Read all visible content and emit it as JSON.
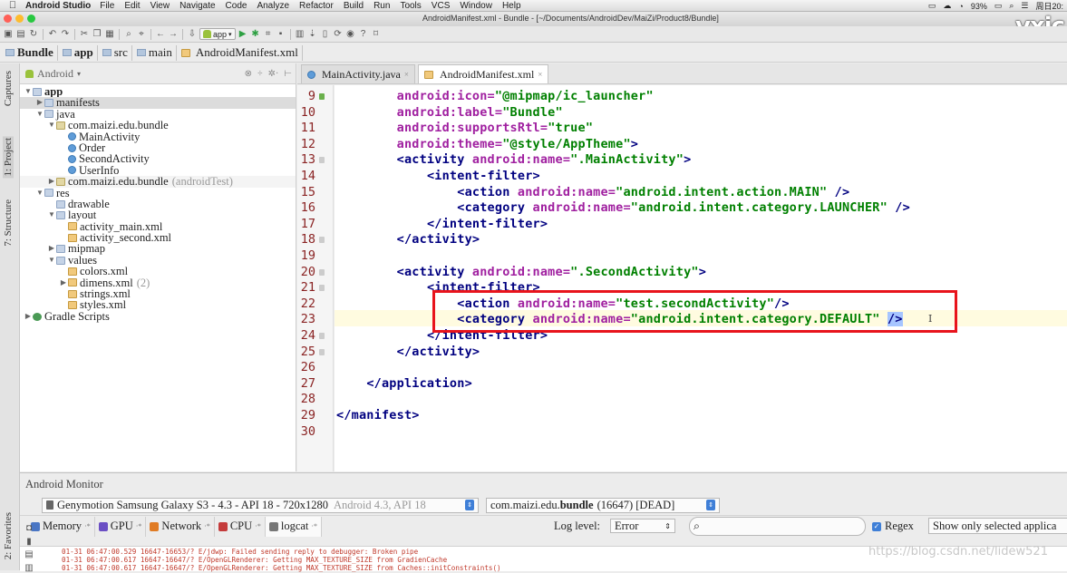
{
  "menubar": {
    "app": "Android Studio",
    "items": [
      "File",
      "Edit",
      "View",
      "Navigate",
      "Code",
      "Analyze",
      "Refactor",
      "Build",
      "Run",
      "Tools",
      "VCS",
      "Window",
      "Help"
    ],
    "battery": "93%",
    "clock": "周日20:"
  },
  "window": {
    "title": "AndroidManifest.xml - Bundle - [~/Documents/AndroidDev/MaiZi/Product8/Bundle]"
  },
  "toolbar": {
    "run_config": "app"
  },
  "breadcrumb": [
    "Bundle",
    "app",
    "src",
    "main",
    "AndroidManifest.xml"
  ],
  "leftstrip": {
    "captures": "Captures",
    "project": "1: Project",
    "structure": "7: Structure",
    "favorites": "2: Favorites"
  },
  "project": {
    "view": "Android",
    "tree": [
      {
        "label": "app",
        "depth": 0,
        "icon": "fold",
        "open": true,
        "bold": true
      },
      {
        "label": "manifests",
        "depth": 1,
        "icon": "fold",
        "open": false,
        "sel": true
      },
      {
        "label": "java",
        "depth": 1,
        "icon": "fold",
        "open": true
      },
      {
        "label": "com.maizi.edu.bundle",
        "depth": 2,
        "icon": "pkg",
        "open": true
      },
      {
        "label": "MainActivity",
        "depth": 3,
        "icon": "cls"
      },
      {
        "label": "Order",
        "depth": 3,
        "icon": "cls"
      },
      {
        "label": "SecondActivity",
        "depth": 3,
        "icon": "cls"
      },
      {
        "label": "UserInfo",
        "depth": 3,
        "icon": "cls"
      },
      {
        "label": "com.maizi.edu.bundle",
        "depth": 2,
        "icon": "pkg",
        "open": false,
        "muted": "(androidTest)",
        "hl": true
      },
      {
        "label": "res",
        "depth": 1,
        "icon": "fold",
        "open": true
      },
      {
        "label": "drawable",
        "depth": 2,
        "icon": "fold"
      },
      {
        "label": "layout",
        "depth": 2,
        "icon": "fold",
        "open": true
      },
      {
        "label": "activity_main.xml",
        "depth": 3,
        "icon": "xml"
      },
      {
        "label": "activity_second.xml",
        "depth": 3,
        "icon": "xml"
      },
      {
        "label": "mipmap",
        "depth": 2,
        "icon": "fold",
        "open": false
      },
      {
        "label": "values",
        "depth": 2,
        "icon": "fold",
        "open": true
      },
      {
        "label": "colors.xml",
        "depth": 3,
        "icon": "xml"
      },
      {
        "label": "dimens.xml",
        "depth": 3,
        "icon": "xml",
        "open": false,
        "muted": "(2)"
      },
      {
        "label": "strings.xml",
        "depth": 3,
        "icon": "xml"
      },
      {
        "label": "styles.xml",
        "depth": 3,
        "icon": "xml"
      },
      {
        "label": "Gradle Scripts",
        "depth": 0,
        "icon": "grad",
        "open": false
      }
    ]
  },
  "editor": {
    "tabs": [
      {
        "label": "MainActivity.java",
        "active": false
      },
      {
        "label": "AndroidManifest.xml",
        "active": true
      }
    ],
    "line_numbers": [
      "9",
      "10",
      "11",
      "12",
      "13",
      "14",
      "15",
      "16",
      "17",
      "18",
      "19",
      "20",
      "21",
      "22",
      "23",
      "24",
      "25",
      "26",
      "27",
      "28",
      "29",
      "30"
    ],
    "lines": [
      [
        {
          "t": "        ",
          "c": "pl"
        },
        {
          "t": "android:icon=",
          "c": "at"
        },
        {
          "t": "\"@mipmap/ic_launcher\"",
          "c": "vl"
        }
      ],
      [
        {
          "t": "        ",
          "c": "pl"
        },
        {
          "t": "android:label=",
          "c": "at"
        },
        {
          "t": "\"Bundle\"",
          "c": "vl"
        }
      ],
      [
        {
          "t": "        ",
          "c": "pl"
        },
        {
          "t": "android:supportsRtl=",
          "c": "at"
        },
        {
          "t": "\"true\"",
          "c": "vl"
        }
      ],
      [
        {
          "t": "        ",
          "c": "pl"
        },
        {
          "t": "android:theme=",
          "c": "at"
        },
        {
          "t": "\"@style/AppTheme\"",
          "c": "vl"
        },
        {
          "t": ">",
          "c": "tg"
        }
      ],
      [
        {
          "t": "        ",
          "c": "pl"
        },
        {
          "t": "<activity ",
          "c": "tg"
        },
        {
          "t": "android:name=",
          "c": "at"
        },
        {
          "t": "\".MainActivity\"",
          "c": "vl"
        },
        {
          "t": ">",
          "c": "tg"
        }
      ],
      [
        {
          "t": "            ",
          "c": "pl"
        },
        {
          "t": "<intent-filter>",
          "c": "tg"
        }
      ],
      [
        {
          "t": "                ",
          "c": "pl"
        },
        {
          "t": "<action ",
          "c": "tg"
        },
        {
          "t": "android:name=",
          "c": "at"
        },
        {
          "t": "\"android.intent.action.MAIN\"",
          "c": "vl"
        },
        {
          "t": " />",
          "c": "tg"
        }
      ],
      [
        {
          "t": "                ",
          "c": "pl"
        },
        {
          "t": "<category ",
          "c": "tg"
        },
        {
          "t": "android:name=",
          "c": "at"
        },
        {
          "t": "\"android.intent.category.LAUNCHER\"",
          "c": "vl"
        },
        {
          "t": " />",
          "c": "tg"
        }
      ],
      [
        {
          "t": "            ",
          "c": "pl"
        },
        {
          "t": "</intent-filter>",
          "c": "tg"
        }
      ],
      [
        {
          "t": "        ",
          "c": "pl"
        },
        {
          "t": "</activity>",
          "c": "tg"
        }
      ],
      [
        {
          "t": "",
          "c": "pl"
        }
      ],
      [
        {
          "t": "        ",
          "c": "pl"
        },
        {
          "t": "<activity ",
          "c": "tg"
        },
        {
          "t": "android:name=",
          "c": "at"
        },
        {
          "t": "\".SecondActivity\"",
          "c": "vl"
        },
        {
          "t": ">",
          "c": "tg"
        }
      ],
      [
        {
          "t": "            ",
          "c": "pl"
        },
        {
          "t": "<intent-filter>",
          "c": "tg"
        }
      ],
      [
        {
          "t": "                ",
          "c": "pl"
        },
        {
          "t": "<action ",
          "c": "tg"
        },
        {
          "t": "android:name=",
          "c": "at"
        },
        {
          "t": "\"test.secondActivity\"",
          "c": "vl"
        },
        {
          "t": "/>",
          "c": "tg"
        }
      ],
      [
        {
          "t": "                ",
          "c": "pl"
        },
        {
          "t": "<category ",
          "c": "tg"
        },
        {
          "t": "android:name=",
          "c": "at"
        },
        {
          "t": "\"android.intent.category.DEFAULT\"",
          "c": "vl"
        },
        {
          "t": " ",
          "c": "pl"
        },
        {
          "t": "/>",
          "c": "tg",
          "sel": true
        }
      ],
      [
        {
          "t": "            ",
          "c": "pl"
        },
        {
          "t": "</intent-filter>",
          "c": "tg"
        }
      ],
      [
        {
          "t": "        ",
          "c": "pl"
        },
        {
          "t": "</activity>",
          "c": "tg"
        }
      ],
      [
        {
          "t": "",
          "c": "pl"
        }
      ],
      [
        {
          "t": "    ",
          "c": "pl"
        },
        {
          "t": "</application>",
          "c": "tg"
        }
      ],
      [
        {
          "t": "",
          "c": "pl"
        }
      ],
      [
        {
          "t": "</manifest>",
          "c": "tg"
        }
      ],
      [
        {
          "t": "",
          "c": "pl"
        }
      ]
    ]
  },
  "monitor": {
    "title": "Android Monitor",
    "device": "Genymotion Samsung Galaxy S3 - 4.3 - API 18 - 720x1280",
    "device_muted": "Android 4.3, API 18",
    "process": "com.maizi.edu.",
    "process_bold": "bundle",
    "process_rest": "(16647) [DEAD]",
    "tabs": [
      "Memory",
      "GPU",
      "Network",
      "CPU",
      "logcat"
    ],
    "log_level_label": "Log level:",
    "log_level": "Error",
    "search_placeholder": "",
    "regex_label": "Regex",
    "filter": "Show only selected applica",
    "log": [
      "01-31 06:47:00.529 16647-16653/? E/jdwp: Failed sending reply to debugger: Broken pipe",
      "01-31 06:47:00.617 16647-16647/? E/OpenGLRenderer: Getting MAX_TEXTURE_SIZE from GradienCache",
      "01-31 06:47:00.617 16647-16647/? E/OpenGLRenderer: Getting MAX_TEXTURE_SIZE from Caches::initConstraints()"
    ]
  },
  "watermark": "https://blog.csdn.net/lidew521",
  "logo_text": "vxic",
  "colors": {
    "tag": "#000080",
    "attr": "#a020a0",
    "value": "#008000",
    "highlight_box": "#e8141c",
    "line_no": "#8a2323"
  }
}
